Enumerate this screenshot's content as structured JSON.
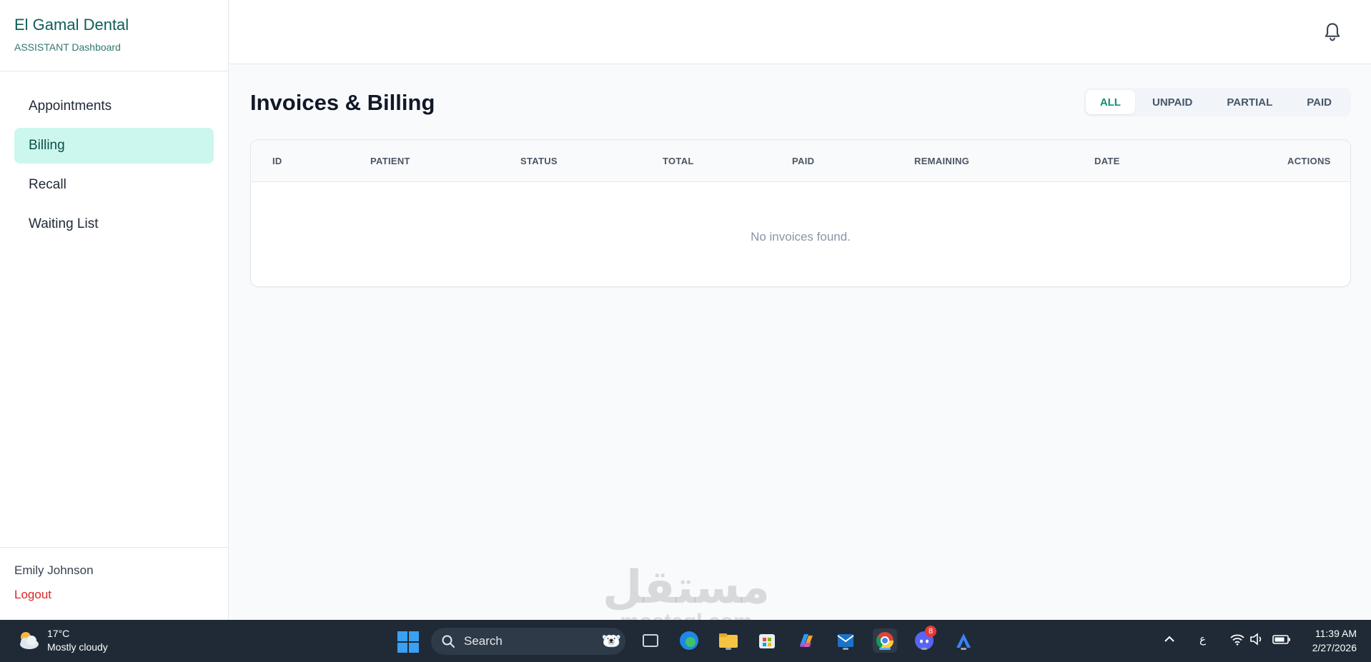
{
  "sidebar": {
    "brand_title": "El Gamal Dental",
    "brand_subtitle": "ASSISTANT Dashboard",
    "items": [
      {
        "label": "Appointments",
        "active": false
      },
      {
        "label": "Billing",
        "active": true
      },
      {
        "label": "Recall",
        "active": false
      },
      {
        "label": "Waiting List",
        "active": false
      }
    ],
    "user_name": "Emily Johnson",
    "logout_label": "Logout"
  },
  "topbar": {
    "notification_icon": "bell-icon"
  },
  "main": {
    "title": "Invoices & Billing",
    "filters": [
      {
        "label": "ALL",
        "active": true
      },
      {
        "label": "UNPAID",
        "active": false
      },
      {
        "label": "PARTIAL",
        "active": false
      },
      {
        "label": "PAID",
        "active": false
      }
    ],
    "table": {
      "columns": [
        "ID",
        "PATIENT",
        "STATUS",
        "TOTAL",
        "PAID",
        "REMAINING",
        "DATE",
        "ACTIONS"
      ],
      "rows": [],
      "empty_message": "No invoices found."
    }
  },
  "watermark": {
    "text": "مستقل",
    "subtext": "mostaql.com"
  },
  "taskbar": {
    "weather_temp": "17°C",
    "weather_desc": "Mostly cloudy",
    "search_label": "Search",
    "discord_badge": "8",
    "input_language": "ع",
    "time": "11:39 AM",
    "date": "2/27/2026"
  },
  "colors": {
    "brand": "#0f5e57",
    "active_nav_bg": "#ccf7ee",
    "active_filter_text": "#0f8f72",
    "logout": "#dc2626",
    "taskbar_bg": "#1f2a36"
  }
}
